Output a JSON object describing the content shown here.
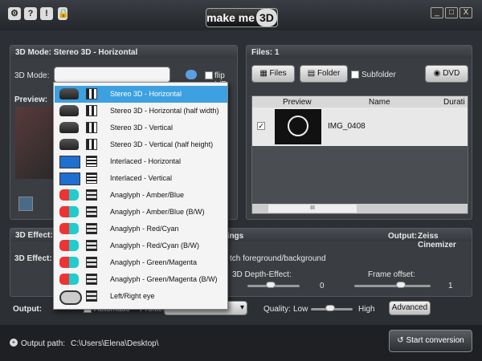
{
  "titlebar": {
    "logo_text": "make me",
    "logo_badge": "3D",
    "icons": [
      "gear-icon",
      "help-icon",
      "info-icon",
      "lock-icon"
    ],
    "window_controls": [
      "_",
      "□",
      "X"
    ]
  },
  "mode_panel": {
    "header": "3D Mode: Stereo 3D - Horizontal",
    "mode_label": "3D Mode:",
    "flip_label": "flip L/R",
    "preview_label": "Preview:"
  },
  "dropdown": {
    "items": [
      "Stereo 3D - Horizontal",
      "Stereo 3D - Horizontal (half width)",
      "Stereo 3D - Vertical",
      "Stereo 3D - Vertical (half height)",
      "Interlaced - Horizontal",
      "Interlaced - Vertical",
      "Anaglyph - Amber/Blue",
      "Anaglyph - Amber/Blue (B/W)",
      "Anaglyph - Red/Cyan",
      "Anaglyph - Red/Cyan (B/W)",
      "Anaglyph - Green/Magenta",
      "Anaglyph - Green/Magenta (B/W)",
      "Left/Right eye"
    ],
    "selected_index": 0
  },
  "files_panel": {
    "header": "Files: 1",
    "files_btn": "Files",
    "folder_btn": "Folder",
    "subfolder_label": "Subfolder",
    "dvd_btn": "DVD",
    "columns": [
      "Preview",
      "Name",
      "Durati"
    ],
    "rows": [
      {
        "checked": true,
        "name": "IMG_0408"
      }
    ],
    "scroll_mid": "III"
  },
  "effect_panel": {
    "header": "3D Effect:",
    "header_mid": "ttings",
    "output_label": "Output:",
    "output_value": "Zeiss Cinemizer",
    "effect_label": "3D Effect:",
    "switch_label": "tch foreground/background",
    "depth_label": "3D Depth-Effect:",
    "depth_value": "0",
    "frame_label": "Frame offset:",
    "frame_value": "1"
  },
  "output_row": {
    "output_label": "Output:",
    "automatic": "Automatic",
    "profile_label": "Profile:",
    "profile_value": "Zeiss Cinemizer",
    "quality_label": "Quality:",
    "low": "Low",
    "high": "High",
    "advanced_btn": "Advanced"
  },
  "bottom": {
    "output_path_label": "Output path:",
    "output_path": "C:\\Users\\Elena\\Desktop\\",
    "start_btn": "Start conversion"
  },
  "colors": {
    "bg": "#2c2f33",
    "panel": "#3a3d42",
    "accent": "#3da0e0"
  }
}
